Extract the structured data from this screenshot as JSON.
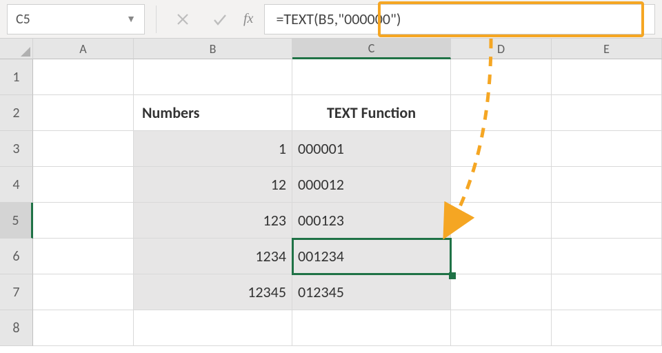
{
  "nameBox": "C5",
  "fxLabel": "fx",
  "formula": "=TEXT(B5,\"000000\")",
  "colHeaders": [
    "A",
    "B",
    "C",
    "D",
    "E"
  ],
  "rowHeaders": [
    "1",
    "2",
    "3",
    "4",
    "5",
    "6",
    "7",
    "8"
  ],
  "activeRowIndex": 4,
  "activeColIndex": 2,
  "tableHeader": {
    "numbers": "Numbers",
    "textfn": "TEXT Function"
  },
  "data": [
    {
      "b": "1",
      "c": "000001"
    },
    {
      "b": "12",
      "c": "000012"
    },
    {
      "b": "123",
      "c": "000123"
    },
    {
      "b": "1234",
      "c": "001234"
    },
    {
      "b": "12345",
      "c": "012345"
    }
  ],
  "colors": {
    "accent": "#00b050",
    "selection": "#1f7246",
    "callout": "#f5a623"
  }
}
